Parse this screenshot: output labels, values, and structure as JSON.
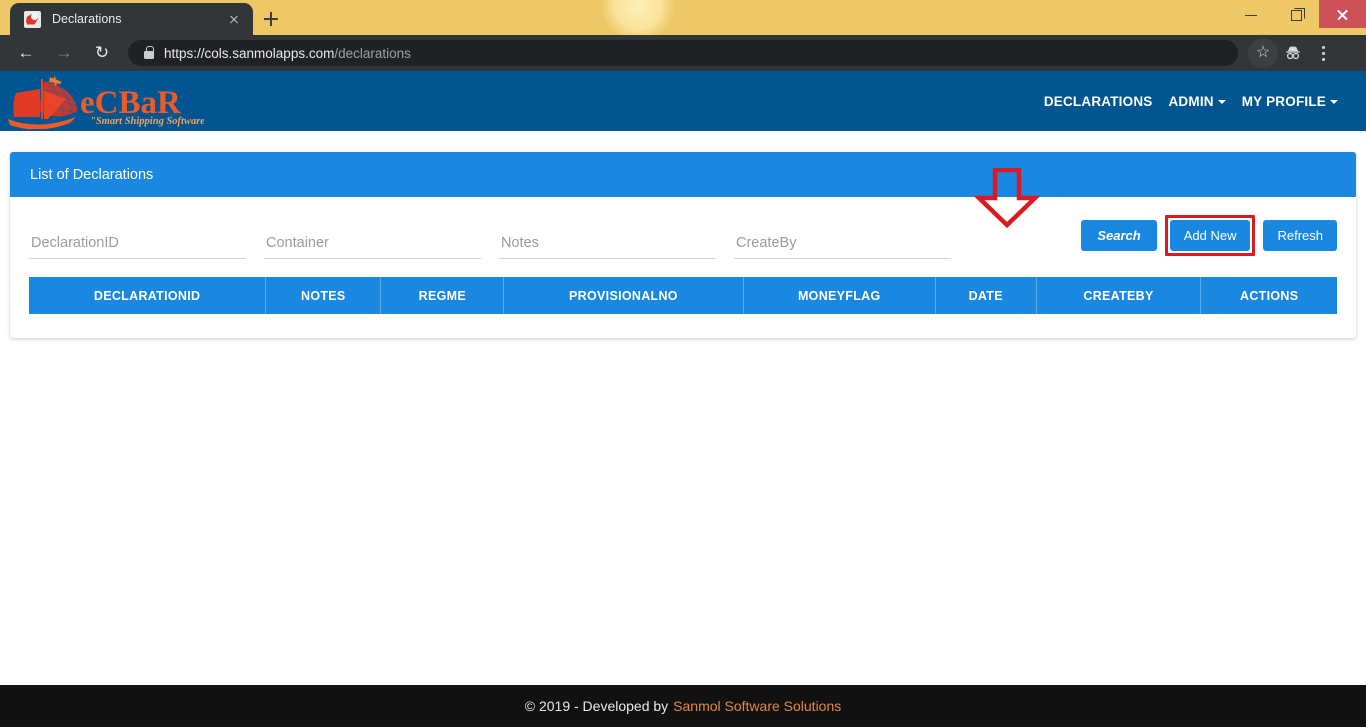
{
  "browser": {
    "tab": {
      "title": "Declarations",
      "favicon": "site-favicon",
      "close_icon": "close-icon"
    },
    "new_tab_tooltip": "New tab",
    "nav": {
      "back": "←",
      "forward": "→",
      "reload": "↻"
    },
    "omnibox": {
      "scheme": "https://",
      "host": "cols.sanmolapps.com",
      "path": "/declarations",
      "full_url": "https://cols.sanmolapps.com/declarations",
      "lock_icon": "lock-icon"
    },
    "toolbar_icons": [
      "bookmark-star-icon",
      "incognito-icon",
      "chrome-menu-icon"
    ],
    "window_controls": [
      "minimize",
      "maximize",
      "close"
    ]
  },
  "site": {
    "logo": {
      "name": "eCBaR",
      "tagline": "\"Smart Shipping Software\""
    },
    "nav_links": [
      {
        "label": "DECLARATIONS",
        "has_caret": false
      },
      {
        "label": "ADMIN",
        "has_caret": true
      },
      {
        "label": "MY PROFILE",
        "has_caret": true
      }
    ]
  },
  "panel": {
    "title": "List of Declarations",
    "filters": [
      {
        "name": "declaration-id",
        "placeholder": "DeclarationID",
        "value": ""
      },
      {
        "name": "container",
        "placeholder": "Container",
        "value": ""
      },
      {
        "name": "notes",
        "placeholder": "Notes",
        "value": ""
      },
      {
        "name": "create-by",
        "placeholder": "CreateBy",
        "value": ""
      }
    ],
    "buttons": [
      {
        "name": "search",
        "label": "Search",
        "style": "italic"
      },
      {
        "name": "add-new",
        "label": "Add New",
        "style": "normal",
        "highlighted": true
      },
      {
        "name": "refresh",
        "label": "Refresh",
        "style": "normal"
      }
    ],
    "annotation": {
      "type": "down-arrow",
      "color": "#d81a22",
      "target": "Add New"
    },
    "table": {
      "columns": [
        "DECLARATIONID",
        "NOTES",
        "REGME",
        "PROVISIONALNO",
        "MONEYFLAG",
        "DATE",
        "CREATEBY",
        "ACTIONS"
      ],
      "rows": [],
      "empty": true
    }
  },
  "footer": {
    "copyright": "© 2019 - Developed by",
    "company": "Sanmol Software Solutions"
  },
  "colors": {
    "navbar": "#015592",
    "accent_blue": "#1a87e0",
    "tabstrip": "#eec867",
    "chrome_dark": "#323639",
    "annotation_red": "#d81a22",
    "footer_bg": "#111111",
    "footer_link": "#e8883a",
    "close_button": "#cc5058"
  }
}
